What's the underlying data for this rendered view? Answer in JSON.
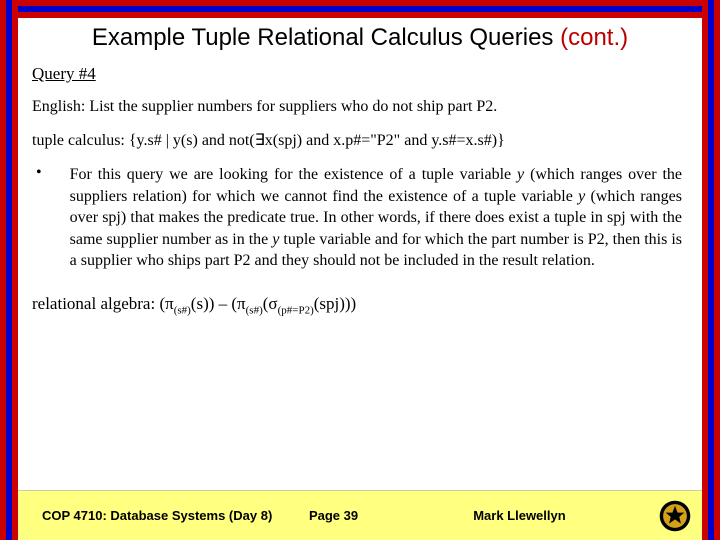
{
  "title_main": "Example Tuple Relational Calculus Queries",
  "title_cont": "(cont.)",
  "query_label": "Query #4",
  "english_prefix": "English:  ",
  "english_text": "List the supplier numbers for suppliers who do not ship part P2.",
  "tuple_prefix": "tuple calculus:  ",
  "tuple_expr": "{y.s# | y(s) and not(∃x(spj) and x.p#=\"P2\" and y.s#=x.s#)}",
  "bullet_mark": "•",
  "bullet_seg1": "For this query we are looking for the existence of a tuple variable ",
  "bullet_y1": "y",
  "bullet_seg2": " (which ranges over the suppliers relation) for which we cannot find the existence of a tuple variable ",
  "bullet_y2": "y",
  "bullet_seg3": " (which ranges over spj) that makes the predicate true.  In other words, if there does exist a tuple in spj with the same supplier number as in the ",
  "bullet_y3": "y",
  "bullet_seg4": " tuple variable and for which the part number is P2, then this is a supplier who ships part P2 and they should not be included in the result relation.",
  "ra_prefix": "relational algebra:  ",
  "ra_p1": "(π",
  "ra_sub1": "(s#)",
  "ra_p2": "(s)) – (π",
  "ra_sub2": "(s#)",
  "ra_p3": "(σ",
  "ra_sub3": "(p#=P2)",
  "ra_p4": "(spj)))",
  "footer_left": "COP 4710: Database Systems  (Day 8)",
  "footer_mid": "Page 39",
  "footer_right": "Mark Llewellyn"
}
